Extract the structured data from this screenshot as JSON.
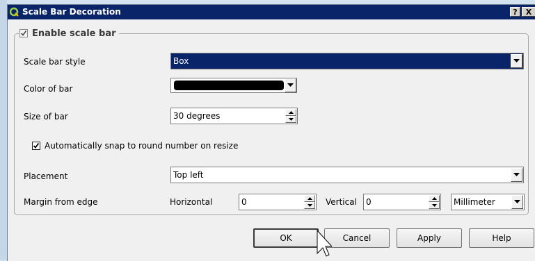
{
  "window": {
    "title": "Scale Bar Decoration",
    "help_button": "?",
    "close_button": "X"
  },
  "group": {
    "label": "Enable scale bar",
    "checked": true
  },
  "style": {
    "label": "Scale bar style",
    "value": "Box"
  },
  "color": {
    "label": "Color of bar",
    "value": "#000000"
  },
  "size": {
    "label": "Size of bar",
    "value": "30 degrees"
  },
  "snap": {
    "label": "Automatically snap to round number on resize",
    "checked": true
  },
  "placement": {
    "label": "Placement",
    "value": "Top left"
  },
  "margin": {
    "label": "Margin from edge",
    "horizontal_label": "Horizontal",
    "horizontal_value": "0",
    "vertical_label": "Vertical",
    "vertical_value": "0",
    "unit": "Millimeter"
  },
  "buttons": {
    "ok": "OK",
    "cancel": "Cancel",
    "apply": "Apply",
    "help": "Help"
  },
  "icons": {
    "app": "qgis-logo-icon",
    "cursor": "mouse-pointer-icon"
  }
}
